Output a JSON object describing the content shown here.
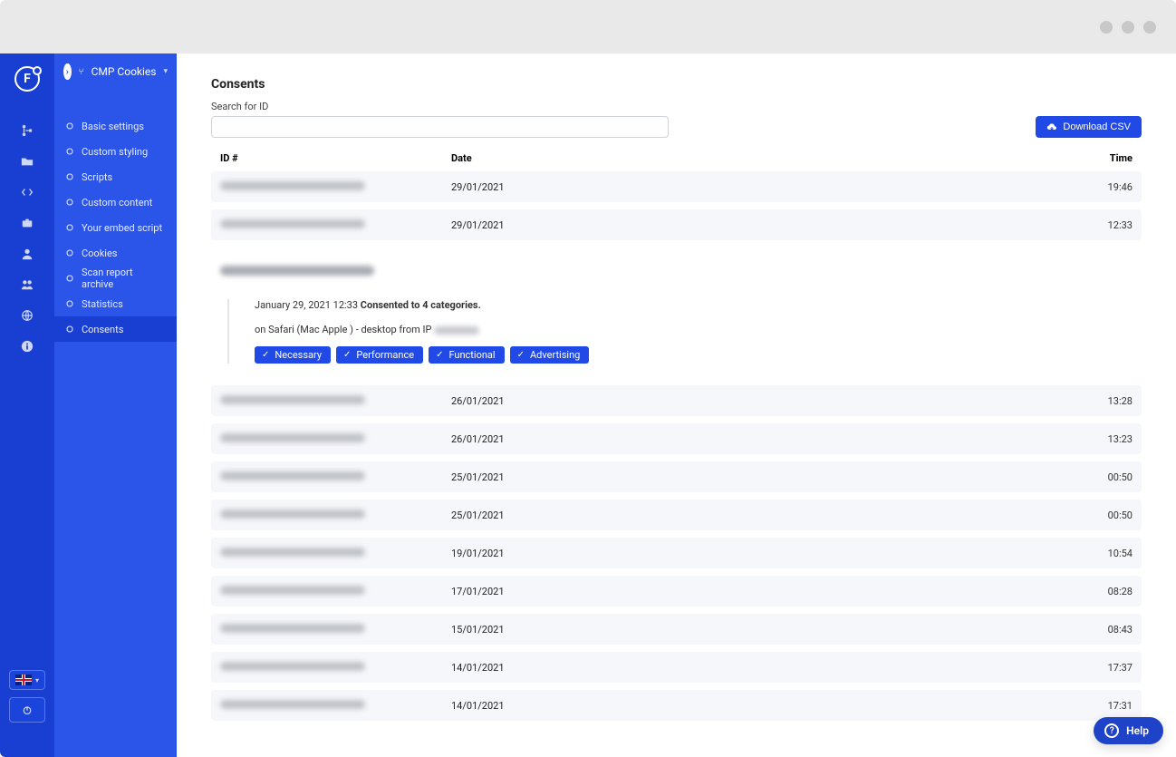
{
  "window": {
    "dots": 3
  },
  "app_name": "CMP Cookies",
  "sidebar": {
    "items": [
      {
        "label": "Basic settings"
      },
      {
        "label": "Custom styling"
      },
      {
        "label": "Scripts"
      },
      {
        "label": "Custom content"
      },
      {
        "label": "Your embed script"
      },
      {
        "label": "Cookies"
      },
      {
        "label": "Scan report archive"
      },
      {
        "label": "Statistics"
      },
      {
        "label": "Consents"
      }
    ],
    "active_index": 8
  },
  "page": {
    "title": "Consents",
    "search_label": "Search for ID",
    "download_label": "Download CSV",
    "columns": {
      "id": "ID #",
      "date": "Date",
      "time": "Time"
    }
  },
  "consents": [
    {
      "date": "29/01/2021",
      "time": "19:46"
    },
    {
      "date": "29/01/2021",
      "time": "12:33"
    }
  ],
  "detail": {
    "timestamp_prefix": "January 29, 2021 12:33 ",
    "summary": "Consented to 4 categories.",
    "agent_prefix": "on Safari (Mac Apple ) - desktop from IP ",
    "categories": [
      "Necessary",
      "Performance",
      "Functional",
      "Advertising"
    ]
  },
  "consents_more": [
    {
      "date": "26/01/2021",
      "time": "13:28"
    },
    {
      "date": "26/01/2021",
      "time": "13:23"
    },
    {
      "date": "25/01/2021",
      "time": "00:50"
    },
    {
      "date": "25/01/2021",
      "time": "00:50"
    },
    {
      "date": "19/01/2021",
      "time": "10:54"
    },
    {
      "date": "17/01/2021",
      "time": "08:28"
    },
    {
      "date": "15/01/2021",
      "time": "08:43"
    },
    {
      "date": "14/01/2021",
      "time": "17:37"
    },
    {
      "date": "14/01/2021",
      "time": "17:31"
    }
  ],
  "help_label": "Help"
}
